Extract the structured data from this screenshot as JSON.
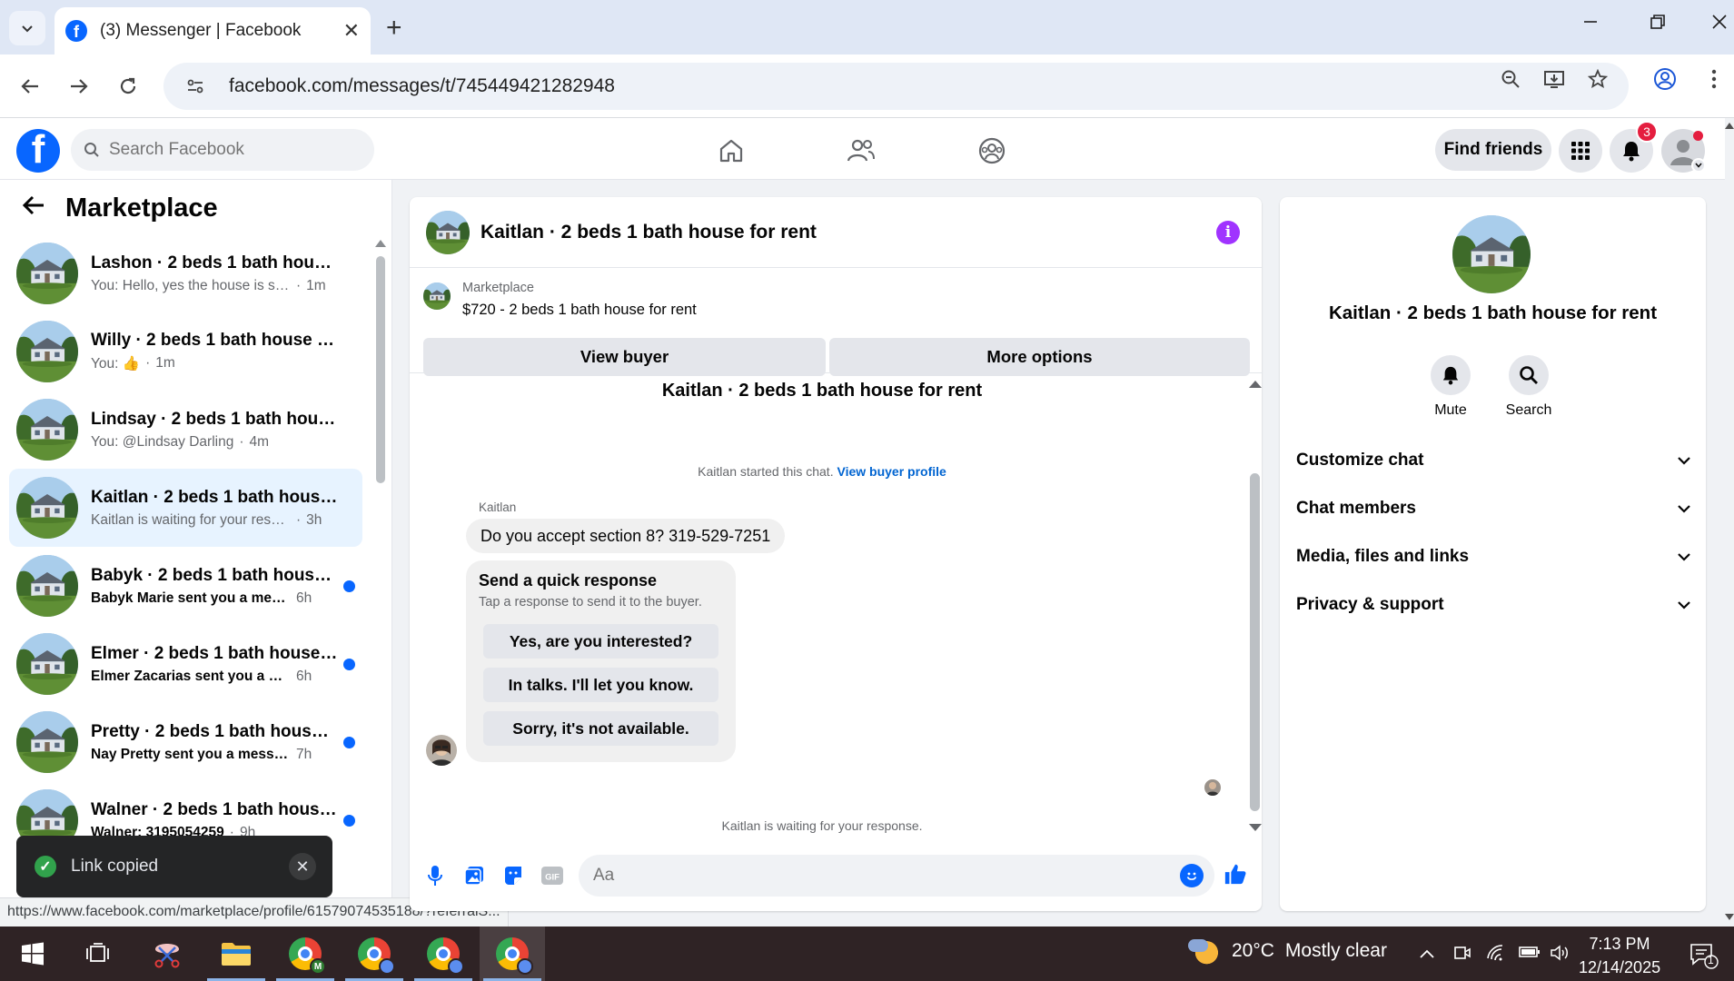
{
  "browser": {
    "tab_title": "(3) Messenger | Facebook",
    "url": "facebook.com/messages/t/745449421282948",
    "status_url": "https://www.facebook.com/marketplace/profile/61579074535188/?referralS..."
  },
  "fb_header": {
    "search_placeholder": "Search Facebook",
    "find_friends_label": "Find friends",
    "notification_count": "3"
  },
  "left_pane": {
    "title": "Marketplace",
    "chats": [
      {
        "name": "Lashon · 2 beds 1 bath house fo...",
        "message": "You: Hello, yes the house is still av...",
        "time": "1m",
        "unread": false
      },
      {
        "name": "Willy · 2 beds 1 bath house for r...",
        "message": "You: 👍",
        "time": "1m",
        "unread": false
      },
      {
        "name": "Lindsay · 2 beds 1 bath house fo...",
        "message": "You: @Lindsay Darling",
        "time": "4m",
        "unread": false
      },
      {
        "name": "Kaitlan · 2 beds 1 bath house fo...",
        "message": "Kaitlan is waiting for your response.",
        "time": "3h",
        "unread": false
      },
      {
        "name": "Babyk · 2 beds 1 bath house f...",
        "message": "Babyk Marie sent you a messag...",
        "time": "6h",
        "unread": true
      },
      {
        "name": "Elmer · 2 beds 1 bath house fo...",
        "message": "Elmer Zacarias sent you a mess...",
        "time": "6h",
        "unread": true
      },
      {
        "name": "Pretty · 2 beds 1 bath house f...",
        "message": "Nay Pretty sent you a message ...",
        "time": "7h",
        "unread": true
      },
      {
        "name": "Walner · 2 beds 1 bath house f...",
        "message": "Walner: 3195054259",
        "time": "9h",
        "unread": true
      }
    ],
    "toast_text": "Link copied"
  },
  "conversation": {
    "title": "Kaitlan · 2 beds 1 bath house for rent",
    "marketplace_label": "Marketplace",
    "listing": "$720 - 2 beds 1 bath house for rent",
    "view_buyer_label": "View buyer",
    "more_options_label": "More options",
    "chat_title": "Kaitlan · 2 beds 1 bath house for rent",
    "started_text": "Kaitlan started this chat.",
    "started_link": "View buyer profile",
    "sender": "Kaitlan",
    "message": "Do you accept section 8? 319-529-7251",
    "quick_title": "Send a quick response",
    "quick_subtitle": "Tap a response to send it to the buyer.",
    "quick_options": [
      "Yes, are you interested?",
      "In talks. I'll let you know.",
      "Sorry, it's not available."
    ],
    "waiting_text": "Kaitlan is waiting for your response.",
    "composer_placeholder": "Aa"
  },
  "right_pane": {
    "name": "Kaitlan · 2 beds 1 bath house for rent",
    "actions": [
      {
        "label": "Mute",
        "icon": "bell-icon"
      },
      {
        "label": "Search",
        "icon": "search-icon"
      }
    ],
    "sections": [
      "Customize chat",
      "Chat members",
      "Media, files and links",
      "Privacy & support"
    ]
  },
  "taskbar": {
    "weather_temp": "20°C",
    "weather_desc": "Mostly clear",
    "time": "7:13 PM",
    "date": "12/14/2025",
    "notif_count": "1"
  },
  "colors": {
    "fb_blue": "#0866ff",
    "unread_dot": "#0866ff",
    "info_purple": "#a033ff",
    "active_row": "#e7f3ff"
  }
}
